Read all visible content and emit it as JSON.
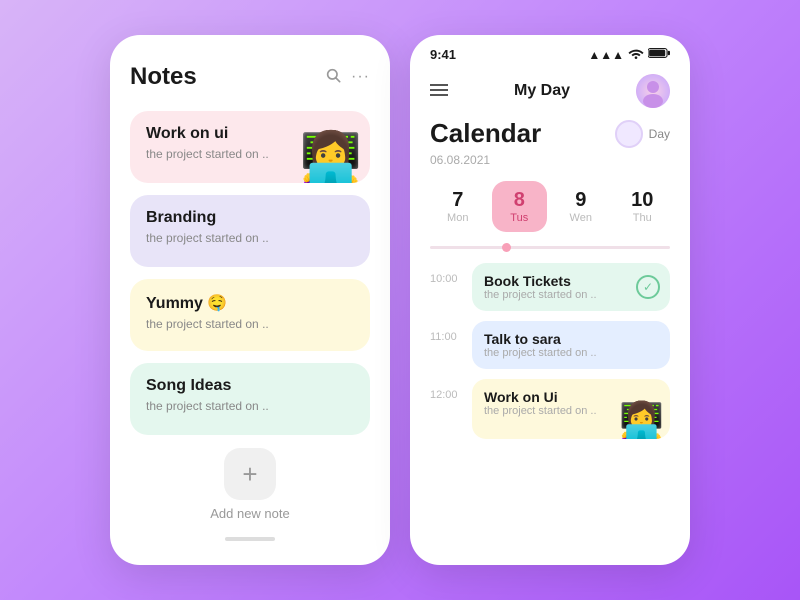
{
  "notes": {
    "title": "Notes",
    "search_icon": "🔍",
    "more_icon": "•••",
    "cards": [
      {
        "id": "work-ui",
        "title": "Work on ui",
        "sub": "the project started on ..",
        "color": "pink",
        "emoji": "👩‍💻"
      },
      {
        "id": "branding",
        "title": "Branding",
        "sub": "the project started on ..",
        "color": "purple",
        "emoji": ""
      },
      {
        "id": "yummy",
        "title": "Yummy 🤤",
        "sub": "the project started on ..",
        "color": "yellow",
        "emoji": ""
      },
      {
        "id": "song-ideas",
        "title": "Song Ideas",
        "sub": "the project started on ..",
        "color": "green",
        "emoji": ""
      }
    ],
    "add_label": "Add new note"
  },
  "calendar": {
    "status_time": "9:41",
    "header_title": "My Day",
    "cal_title": "Calendar",
    "date_sub": "06.08.2021",
    "toggle_label": "Day",
    "days": [
      {
        "num": "7",
        "name": "Mon",
        "active": false
      },
      {
        "num": "8",
        "name": "Tus",
        "active": true
      },
      {
        "num": "9",
        "name": "Wen",
        "active": false
      },
      {
        "num": "10",
        "name": "Thu",
        "active": false
      }
    ],
    "events": [
      {
        "time": "10:00",
        "title": "Book Tickets",
        "sub": "the project started on ..",
        "color": "green-bg",
        "check": true,
        "emoji": ""
      },
      {
        "time": "11:00",
        "title": "Talk to sara",
        "sub": "the project started on ..",
        "color": "blue-bg",
        "check": false,
        "emoji": ""
      },
      {
        "time": "12:00",
        "title": "Work on Ui",
        "sub": "the project started on ..",
        "color": "yellow-bg",
        "check": false,
        "emoji": "👩‍💻"
      }
    ]
  }
}
